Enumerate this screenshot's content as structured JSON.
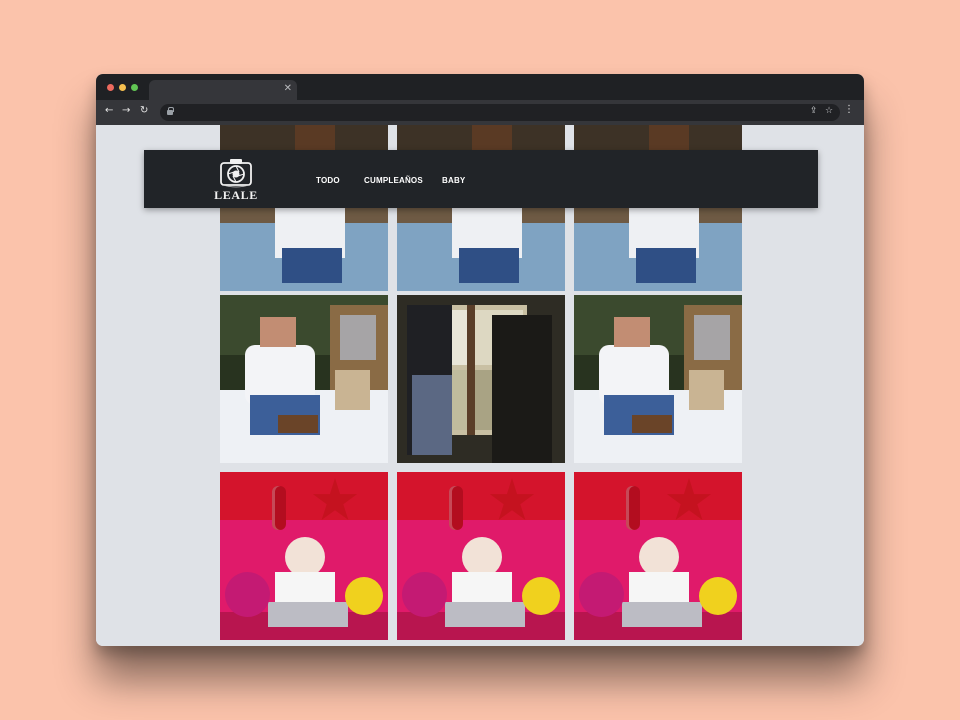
{
  "browser": {
    "tab_close": "✕",
    "back": "←",
    "forward": "→",
    "reload": "↻",
    "share": "⇪",
    "bookmark": "☆",
    "menu": "⋮"
  },
  "site": {
    "logo_text": "LEALE",
    "nav": {
      "todo": "TODO",
      "cumpleanos": "CUMPLEAÑOS",
      "baby": "BABY"
    }
  },
  "gallery": {
    "photos": [
      {
        "subject": "baby-white-sweater-teddy",
        "theme": "sepia-outdoor"
      },
      {
        "subject": "baby-toys-blanket",
        "theme": "sepia-outdoor"
      },
      {
        "subject": "baby-with-toy",
        "theme": "sepia-outdoor"
      },
      {
        "subject": "baby-teddy-bears-white-sheet",
        "theme": "outdoor-sheet"
      },
      {
        "subject": "mother-holding-baby-window",
        "theme": "window-silhouette"
      },
      {
        "subject": "baby-teddy-bears-white-sheet",
        "theme": "outdoor-sheet"
      },
      {
        "subject": "baby-red-balloons-number-1",
        "theme": "red-birthday"
      },
      {
        "subject": "baby-red-balloons-number-1",
        "theme": "red-birthday"
      },
      {
        "subject": "baby-red-balloons-number-1",
        "theme": "red-birthday"
      }
    ]
  },
  "colors": {
    "backdrop": "#fbc3ab",
    "page_bg": "#dfe2e7",
    "navbar_bg": "#212428",
    "browser_chrome": "#35363a",
    "birthday_red": "#d4142c",
    "birthday_pink": "#e01a6a"
  }
}
